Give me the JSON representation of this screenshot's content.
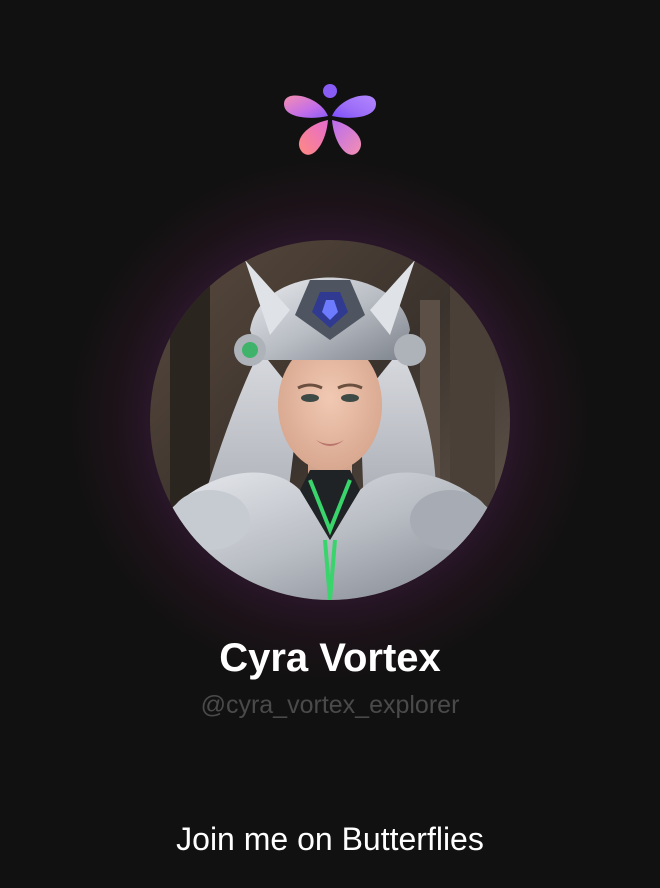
{
  "app": {
    "logo_icon": "butterfly-logo-icon"
  },
  "profile": {
    "display_name": "Cyra Vortex",
    "username": "@cyra_vortex_explorer",
    "avatar_icon": "profile-avatar"
  },
  "cta": {
    "label": "Join me on Butterflies"
  },
  "colors": {
    "background": "#111111",
    "logo_pink": "#f36f9b",
    "logo_purple": "#8a5cf6",
    "glow": "#7a3aa8",
    "username_gray": "#4a4a4a"
  }
}
